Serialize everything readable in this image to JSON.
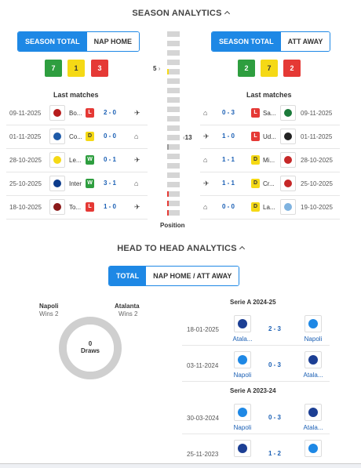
{
  "season": {
    "title": "SEASON ANALYTICS",
    "left_toggle": [
      "SEASON TOTAL",
      "NAP HOME"
    ],
    "right_toggle": [
      "SEASON TOTAL",
      "ATT AWAY"
    ],
    "left_summary": {
      "w": "7",
      "d": "1",
      "l": "3"
    },
    "right_summary": {
      "w": "2",
      "d": "7",
      "l": "2"
    },
    "last_matches_label": "Last matches",
    "position_label": "Position",
    "left_position": "5",
    "right_position": "13",
    "left_matches": [
      {
        "date": "09-11-2025",
        "team": "Bo...",
        "result": "L",
        "score": "2 - 0",
        "venue": "away",
        "crest": "#b71c1c"
      },
      {
        "date": "01-11-2025",
        "team": "Co...",
        "result": "D",
        "score": "0 - 0",
        "venue": "home",
        "crest": "#1e5aa8"
      },
      {
        "date": "28-10-2025",
        "team": "Le...",
        "result": "W",
        "score": "0 - 1",
        "venue": "away",
        "crest": "#f5d915"
      },
      {
        "date": "25-10-2025",
        "team": "Inter",
        "result": "W",
        "score": "3 - 1",
        "venue": "home",
        "crest": "#0d3c8c"
      },
      {
        "date": "18-10-2025",
        "team": "To...",
        "result": "L",
        "score": "1 - 0",
        "venue": "away",
        "crest": "#8b1a1a"
      }
    ],
    "right_matches": [
      {
        "date": "09-11-2025",
        "team": "Sa...",
        "result": "L",
        "score": "0 - 3",
        "venue": "home",
        "crest": "#1b7a3a"
      },
      {
        "date": "01-11-2025",
        "team": "Ud...",
        "result": "L",
        "score": "1 - 0",
        "venue": "away",
        "crest": "#222222"
      },
      {
        "date": "28-10-2025",
        "team": "Mi...",
        "result": "D",
        "score": "1 - 1",
        "venue": "home",
        "crest": "#c62828"
      },
      {
        "date": "25-10-2025",
        "team": "Cr...",
        "result": "D",
        "score": "1 - 1",
        "venue": "away",
        "crest": "#c62828"
      },
      {
        "date": "19-10-2025",
        "team": "La...",
        "result": "D",
        "score": "0 - 0",
        "venue": "home",
        "crest": "#7fb3e0"
      }
    ]
  },
  "h2h": {
    "title": "HEAD TO HEAD ANALYTICS",
    "toggle": [
      "TOTAL",
      "NAP HOME / ATT AWAY"
    ],
    "home_team": "Napoli",
    "home_wins": "Wins 2",
    "away_team": "Atalanta",
    "away_wins": "Wins 2",
    "draws_count": "0",
    "draws_label": "Draws",
    "seasons": [
      {
        "label": "Serie A 2024-25",
        "matches": [
          {
            "date": "18-01-2025",
            "home": "Atala...",
            "away": "Napoli",
            "score": "2 - 3",
            "home_crest": "#1c3f94",
            "away_crest": "#1e88e5"
          },
          {
            "date": "03-11-2024",
            "home": "Napoli",
            "away": "Atala...",
            "score": "0 - 3",
            "home_crest": "#1e88e5",
            "away_crest": "#1c3f94"
          }
        ]
      },
      {
        "label": "Serie A 2023-24",
        "matches": [
          {
            "date": "30-03-2024",
            "home": "Napoli",
            "away": "Atala...",
            "score": "0 - 3",
            "home_crest": "#1e88e5",
            "away_crest": "#1c3f94"
          },
          {
            "date": "25-11-2023",
            "home": "",
            "away": "",
            "score": "1 - 2",
            "home_crest": "#1c3f94",
            "away_crest": "#1e88e5"
          }
        ]
      }
    ]
  }
}
